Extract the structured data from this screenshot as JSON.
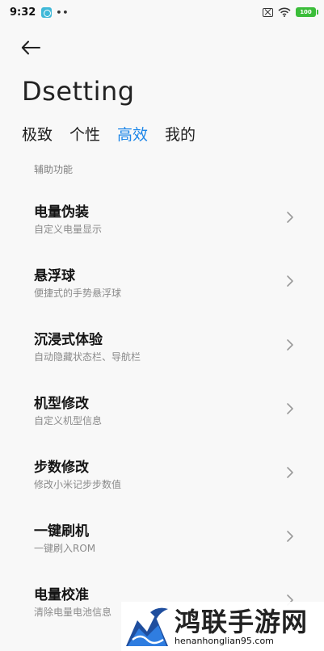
{
  "status_bar": {
    "time": "9:32",
    "dots": "••",
    "battery": "100"
  },
  "header": {
    "title": "Dsetting"
  },
  "tabs": [
    {
      "label": "极致",
      "active": false
    },
    {
      "label": "个性",
      "active": false
    },
    {
      "label": "高效",
      "active": true
    },
    {
      "label": "我的",
      "active": false
    }
  ],
  "section": {
    "header": "辅助功能"
  },
  "items": [
    {
      "title": "电量伪装",
      "subtitle": "自定义电量显示"
    },
    {
      "title": "悬浮球",
      "subtitle": "便捷式的手势悬浮球"
    },
    {
      "title": "沉浸式体验",
      "subtitle": "自动隐藏状态栏、导航栏"
    },
    {
      "title": "机型修改",
      "subtitle": "自定义机型信息"
    },
    {
      "title": "步数修改",
      "subtitle": "修改小米记步步数值"
    },
    {
      "title": "一键刷机",
      "subtitle": "一键刷入ROM"
    },
    {
      "title": "电量校准",
      "subtitle": "清除电量电池信息"
    }
  ],
  "colors": {
    "accent": "#1d86e8",
    "battery": "#3bbd3a"
  },
  "watermark": {
    "name": "鸿联手游网",
    "url": "henanhonglian95.com"
  }
}
